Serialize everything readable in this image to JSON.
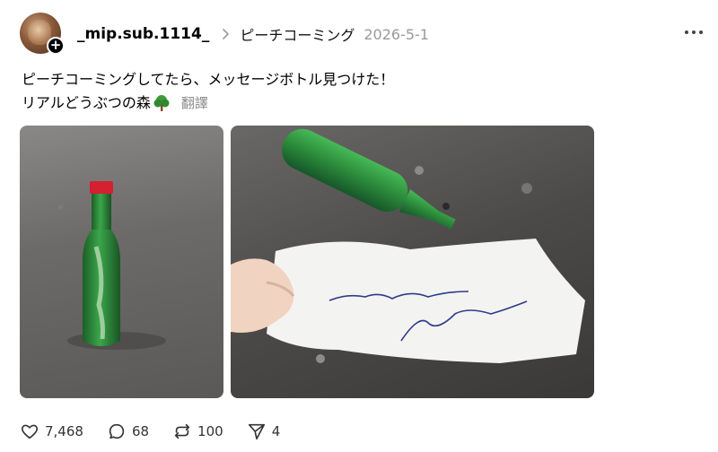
{
  "post": {
    "username": "_mip.sub.1114_",
    "community": "ピーチコーミング",
    "date": "2026-5-1",
    "text_line1": "ピーチコーミングしてたら、メッセージボトル見つけた！",
    "text_line2": "リアルどうぶつの森",
    "translate_label": "翻譯"
  },
  "stats": {
    "likes": "7,468",
    "comments": "68",
    "reposts": "100",
    "shares": "4"
  },
  "colors": {
    "bottle_green": "#2f8a3e",
    "cap_red": "#d42030",
    "muted_text": "#9a9a9a"
  }
}
